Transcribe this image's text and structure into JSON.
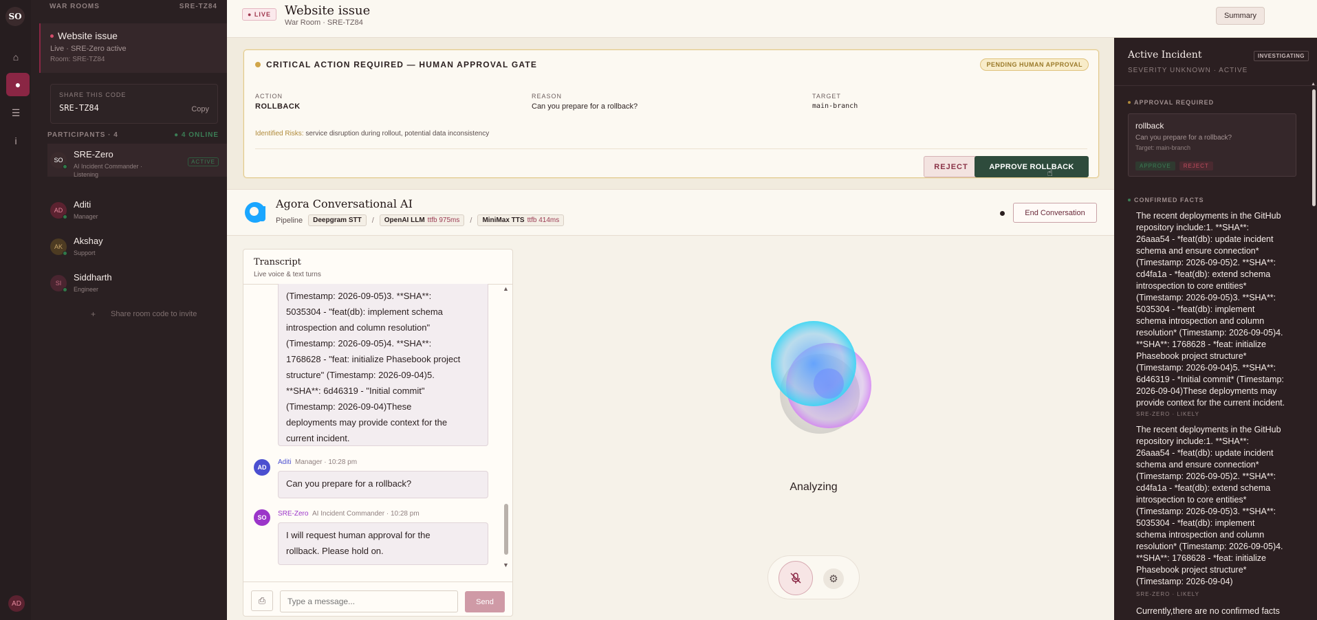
{
  "rail": {
    "user_initials": "SO",
    "footer_initials": "AD"
  },
  "sidebar": {
    "section_title": "WAR ROOMS",
    "section_code": "SRE-TZ84",
    "room": {
      "title": "Website issue",
      "status": "Live · SRE-Zero active",
      "room_label": "Room: SRE-TZ84"
    },
    "share": {
      "label": "SHARE THIS CODE",
      "code": "SRE-TZ84",
      "copy_label": "Copy"
    },
    "participants_title": "PARTICIPANTS · 4",
    "participants_online": "● 4 ONLINE",
    "participants": [
      {
        "initials": "SO",
        "name": "SRE-Zero",
        "role": "AI Incident Commander · Listening",
        "badge": "ACTIVE",
        "color": "#3a2a2c",
        "text_color": "#ffffff"
      },
      {
        "initials": "AD",
        "name": "Aditi",
        "role": "Manager",
        "badge": "",
        "color": "#5b2230",
        "text_color": "#e58a9e"
      },
      {
        "initials": "AK",
        "name": "Akshay",
        "role": "Support",
        "badge": "",
        "color": "#4d3b22",
        "text_color": "#c9a66a"
      },
      {
        "initials": "SI",
        "name": "Siddharth",
        "role": "Engineer",
        "badge": "",
        "color": "#4a2530",
        "text_color": "#c46a80"
      }
    ],
    "invite_label": "Share room code to invite",
    "invite_plus": "+"
  },
  "header": {
    "live_badge": "● LIVE",
    "title": "Website issue",
    "subtitle": "War Room · SRE-TZ84",
    "summary_label": "Summary"
  },
  "approval": {
    "title": "CRITICAL ACTION REQUIRED — HUMAN APPROVAL GATE",
    "status_badge": "PENDING HUMAN APPROVAL",
    "action_key": "ACTION",
    "action_value": "ROLLBACK",
    "reason_key": "REASON",
    "reason_value": "Can you prepare for a rollback?",
    "target_key": "TARGET",
    "target_value": "main-branch",
    "risks_key": "Identified Risks:",
    "risks_value": "service disruption during rollout, potential data inconsistency",
    "reject_label": "REJECT",
    "approve_label": "APPROVE ROLLBACK"
  },
  "agora": {
    "title": "Agora Conversational AI",
    "pipeline_label": "Pipeline",
    "stt": "Deepgram STT",
    "llm": "OpenAI LLM",
    "llm_ttfb": "ttfb 975ms",
    "tts": "MiniMax TTS",
    "tts_ttfb": "ttfb 414ms",
    "separator": "/",
    "end_label": "End Conversation"
  },
  "transcript": {
    "title": "Transcript",
    "subtitle": "Live voice & text turns",
    "bubble1_lines": [
      "(Timestamp: 2026-09-05)3. **SHA**:",
      "5035304 - \"feat(db): implement schema",
      "introspection and column resolution\"",
      "(Timestamp: 2026-09-05)4. **SHA**:",
      "1768628 - \"feat: initialize Phasebook project",
      "structure\" (Timestamp: 2026-09-04)5.",
      "**SHA**: 6d46319 - \"Initial commit\"",
      "(Timestamp: 2026-09-04)These",
      "deployments may provide context for the",
      "current incident."
    ],
    "msg2": {
      "initials": "AD",
      "name": "Aditi",
      "meta": "Manager · 10:28 pm",
      "text": "Can you prepare for a rollback?"
    },
    "msg3": {
      "initials": "SO",
      "name": "SRE-Zero",
      "meta": "AI Incident Commander · 10:28 pm",
      "text_line1": "I will request human approval for the",
      "text_line2": "rollback. Please hold on."
    },
    "placeholder": "Type a message...",
    "send_label": "Send"
  },
  "agent_state": "Analyzing",
  "right_panel": {
    "title": "Active Incident",
    "status_badge": "INVESTIGATING",
    "subtitle": "SEVERITY UNKNOWN · ACTIVE",
    "approval_section": "APPROVAL REQUIRED",
    "approval_name": "rollback",
    "approval_question": "Can you prepare for a rollback?",
    "approval_target": "Target: main-branch",
    "approve_label": "APPROVE",
    "reject_label": "REJECT",
    "facts_section": "CONFIRMED FACTS",
    "fact1_lines": [
      "The recent deployments in the GitHub",
      "repository include:1. **SHA**:",
      "26aaa54 - *feat(db): update incident",
      "schema and ensure connection*",
      "(Timestamp: 2026-09-05)2. **SHA**:",
      "cd4fa1a - *feat(db): extend schema",
      "introspection to core entities*",
      "(Timestamp: 2026-09-05)3. **SHA**:",
      "5035304 - *feat(db): implement",
      "schema introspection and column",
      "resolution* (Timestamp: 2026-09-05)4.",
      "**SHA**: 1768628 - *feat: initialize",
      "Phasebook project structure*",
      "(Timestamp: 2026-09-04)5. **SHA**:",
      "6d46319 - *Initial commit* (Timestamp:",
      "2026-09-04)These deployments may",
      "provide context for the current incident."
    ],
    "fact1_meta": "SRE-ZERO · LIKELY",
    "fact2_lines": [
      "The recent deployments in the GitHub",
      "repository include:1. **SHA**:",
      "26aaa54 - *feat(db): update incident",
      "schema and ensure connection*",
      "(Timestamp: 2026-09-05)2. **SHA**:",
      "cd4fa1a - *feat(db): extend schema",
      "introspection to core entities*",
      "(Timestamp: 2026-09-05)3. **SHA**:",
      "5035304 - *feat(db): implement",
      "schema introspection and column",
      "resolution* (Timestamp: 2026-09-05)4.",
      "**SHA**: 1768628 - *feat: initialize",
      "Phasebook project structure*",
      "(Timestamp: 2026-09-04)"
    ],
    "fact2_meta": "SRE-ZERO · LIKELY",
    "fact3_line": "Currently,there are no confirmed facts"
  },
  "colors": {
    "accent": "#8a2644",
    "approve": "#2e4b3c",
    "sidebar_bg": "#2a2022",
    "page_bg": "#f6f2e9"
  }
}
